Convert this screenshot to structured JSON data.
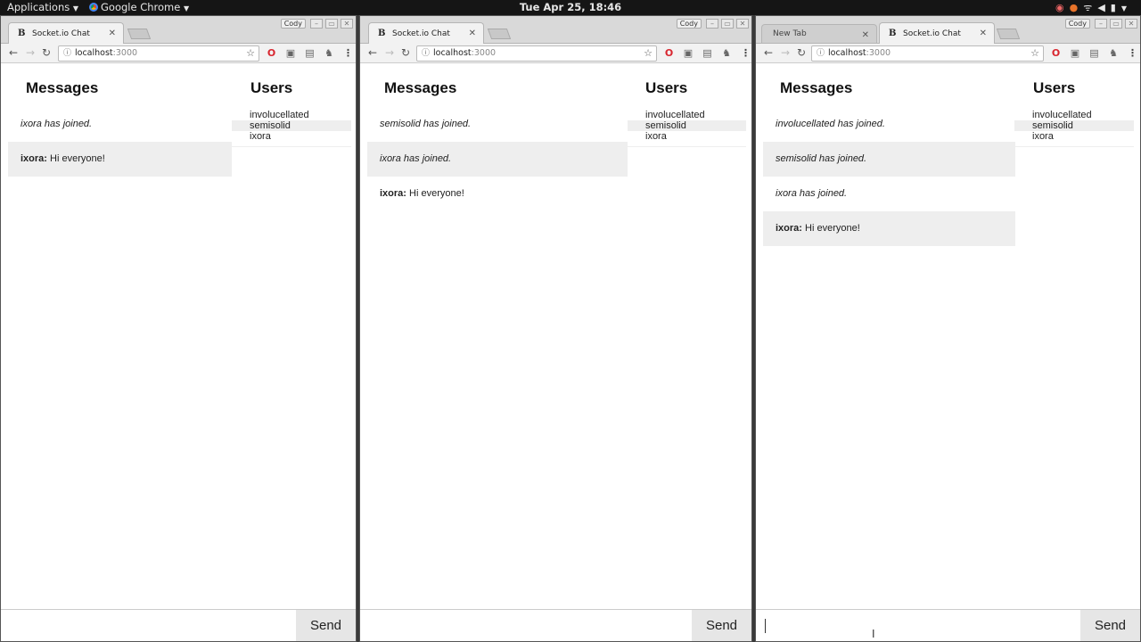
{
  "desktop": {
    "applications_label": "Applications",
    "chrome_label": "Google Chrome",
    "clock": "Tue Apr 25, 18:46"
  },
  "browser": {
    "profile_label": "Cody",
    "url_host": "localhost",
    "url_port": ":3000",
    "new_tab_label": "New Tab",
    "chat_tab_label": "Socket.io Chat",
    "favicon": "B"
  },
  "app": {
    "messages_heading": "Messages",
    "users_heading": "Users",
    "send_label": "Send"
  },
  "windows": [
    {
      "messages": [
        {
          "type": "system",
          "text": "ixora has joined."
        },
        {
          "type": "chat",
          "user": "ixora:",
          "text": " Hi everyone!"
        }
      ],
      "users": [
        "involucellated",
        "semisolid",
        "ixora"
      ]
    },
    {
      "messages": [
        {
          "type": "system",
          "text": "semisolid has joined."
        },
        {
          "type": "system",
          "text": "ixora has joined."
        },
        {
          "type": "chat",
          "user": "ixora:",
          "text": " Hi everyone!"
        }
      ],
      "users": [
        "involucellated",
        "semisolid",
        "ixora"
      ]
    },
    {
      "messages": [
        {
          "type": "system",
          "text": "involucellated has joined."
        },
        {
          "type": "system",
          "text": "semisolid has joined."
        },
        {
          "type": "system",
          "text": "ixora has joined."
        },
        {
          "type": "chat",
          "user": "ixora:",
          "text": " Hi everyone!"
        }
      ],
      "users": [
        "involucellated",
        "semisolid",
        "ixora"
      ]
    }
  ]
}
